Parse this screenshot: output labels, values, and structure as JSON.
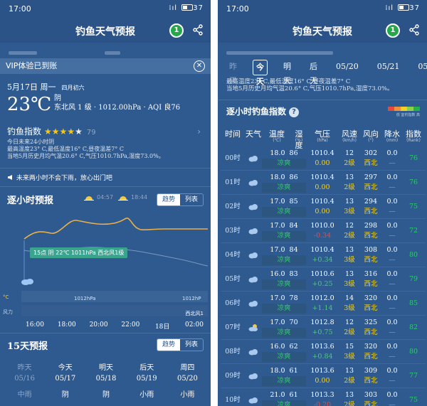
{
  "status": {
    "time": "17:00",
    "signal": "⁞ıl",
    "battery": "37"
  },
  "app_title": "钓鱼天气预报",
  "badge_number": "1",
  "left": {
    "vip_banner": "VIP体验已到账",
    "date": "5月17日 周一",
    "lunar": "四月初六",
    "temperature": "23℃",
    "weather": "阴",
    "wind_pressure_aqi": "东北风 1 级 · 1012.00hPa · AQI 良76",
    "fishing_index_label": "钓鱼指数",
    "fishing_index_score": "79",
    "fishing_stars": 4,
    "summary_lines": [
      "今日未来24小时阴",
      "最高温度23° C,最低温度16° C,昼夜温差7° C",
      "当地5月历史月均气温20.6° C,气压1010.7hPa,湿度73.0%。"
    ],
    "alert": "未来两小时不会下雨，放心出门吧",
    "hourly_title": "逐小时预报",
    "sunrise_time": "04:57",
    "sunset_time": "18:44",
    "toggle_trend": "趋势",
    "toggle_list": "列表",
    "tooltip": "15点 阴 22℃ 1011hPa 西北风1级",
    "temp_axis_label": "°C",
    "pressure_labels": [
      "1012hPa",
      "1012hP"
    ],
    "wind_label": "风力",
    "wind_dir_label": "西北风1",
    "hour_axis": [
      "16:00",
      "18:00",
      "20:00",
      "22:00",
      "18日",
      "02:00"
    ],
    "daily_title": "15天预报",
    "daily_names": [
      "昨天",
      "今天",
      "明天",
      "后天",
      "周四"
    ],
    "daily_dates": [
      "05/16",
      "05/17",
      "05/18",
      "05/19",
      "05/20"
    ],
    "daily_weather": [
      "中雨",
      "阴",
      "阴",
      "小雨",
      "小雨"
    ],
    "colors": {
      "accent_green": "#3aa48f",
      "star": "#f6c620",
      "temp_line": "#e8b04a"
    }
  },
  "right": {
    "tabs": [
      "昨天",
      "今天",
      "明天",
      "后天",
      "05/20",
      "05/21",
      "05/"
    ],
    "forecast_lines": [
      "最高温度23° C,最低温度16° C,昼夜温差7° C",
      "当地5月历史月均气温20.6° C,气压1010.7hPa,湿度73.0%。"
    ],
    "fishing_title": "逐小时钓鱼指数",
    "help": "?",
    "legend_label": "低 宜钓指数 高",
    "headers": [
      "时间",
      "天气",
      "温度",
      "湿度",
      "气压",
      "风速",
      "风向",
      "降水",
      "指数"
    ],
    "units": [
      "",
      "",
      "(℃)",
      "(%)",
      "(hPa)",
      "(km/h)",
      "(°)",
      "(mm)",
      "(Rank)"
    ],
    "rows": [
      {
        "hour": "00时",
        "temp": "18.0",
        "hum": "86",
        "comfort": "凉爽",
        "press": "1010.4",
        "dp": "0.00",
        "dpc": "dp",
        "speed": "12",
        "level": "2级",
        "dir_deg": "302",
        "dir": "西北",
        "rain": "0.0",
        "rain2": "—",
        "idx": "76",
        "icon": "cloud"
      },
      {
        "hour": "01时",
        "temp": "18.0",
        "hum": "86",
        "comfort": "凉爽",
        "press": "1010.4",
        "dp": "0.00",
        "dpc": "dp",
        "speed": "13",
        "level": "2级",
        "dir_deg": "297",
        "dir": "西北",
        "rain": "0.0",
        "rain2": "—",
        "idx": "76",
        "icon": "cloud"
      },
      {
        "hour": "02时",
        "temp": "17.0",
        "hum": "85",
        "comfort": "凉爽",
        "press": "1010.4",
        "dp": "0.00",
        "dpc": "dp",
        "speed": "13",
        "level": "3级",
        "dir_deg": "294",
        "dir": "西北",
        "rain": "0.0",
        "rain2": "—",
        "idx": "75",
        "icon": "cloud"
      },
      {
        "hour": "03时",
        "temp": "17.0",
        "hum": "84",
        "comfort": "凉爽",
        "press": "1010.0",
        "dp": "-0.34",
        "dpc": "dn",
        "speed": "12",
        "level": "2级",
        "dir_deg": "298",
        "dir": "西北",
        "rain": "0.0",
        "rain2": "—",
        "idx": "72",
        "icon": "cloud"
      },
      {
        "hour": "04时",
        "temp": "17.0",
        "hum": "84",
        "comfort": "凉爽",
        "press": "1010.4",
        "dp": "+0.34",
        "dpc": "dg",
        "speed": "13",
        "level": "3级",
        "dir_deg": "308",
        "dir": "西北",
        "rain": "0.0",
        "rain2": "—",
        "idx": "80",
        "icon": "cloud"
      },
      {
        "hour": "05时",
        "temp": "16.0",
        "hum": "83",
        "comfort": "凉爽",
        "press": "1010.6",
        "dp": "+0.25",
        "dpc": "dg",
        "speed": "13",
        "level": "3级",
        "dir_deg": "316",
        "dir": "西北",
        "rain": "0.0",
        "rain2": "—",
        "idx": "79",
        "icon": "cloud"
      },
      {
        "hour": "06时",
        "temp": "17.0",
        "hum": "78",
        "comfort": "凉爽",
        "press": "1012.0",
        "dp": "+1.14",
        "dpc": "dg",
        "speed": "14",
        "level": "3级",
        "dir_deg": "320",
        "dir": "西北",
        "rain": "0.0",
        "rain2": "—",
        "idx": "85",
        "icon": "cloud"
      },
      {
        "hour": "07时",
        "temp": "17.0",
        "hum": "70",
        "comfort": "凉爽",
        "press": "1012.8",
        "dp": "+0.75",
        "dpc": "dg",
        "speed": "12",
        "level": "2级",
        "dir_deg": "325",
        "dir": "西北",
        "rain": "0.0",
        "rain2": "—",
        "idx": "82",
        "icon": "suncloud"
      },
      {
        "hour": "08时",
        "temp": "16.0",
        "hum": "62",
        "comfort": "凉爽",
        "press": "1013.6",
        "dp": "+0.84",
        "dpc": "dg",
        "speed": "15",
        "level": "3级",
        "dir_deg": "320",
        "dir": "西北",
        "rain": "0.0",
        "rain2": "—",
        "idx": "80",
        "icon": "cloud"
      },
      {
        "hour": "09时",
        "temp": "18.0",
        "hum": "61",
        "comfort": "凉爽",
        "press": "1013.6",
        "dp": "0.00",
        "dpc": "dp",
        "speed": "13",
        "level": "2级",
        "dir_deg": "309",
        "dir": "西北",
        "rain": "0.0",
        "rain2": "—",
        "idx": "77",
        "icon": "cloud"
      },
      {
        "hour": "10时",
        "temp": "21.0",
        "hum": "61",
        "comfort": "凉爽",
        "press": "1013.3",
        "dp": "-0.20",
        "dpc": "dn",
        "speed": "13",
        "level": "2级",
        "dir_deg": "303",
        "dir": "西北",
        "rain": "0.0",
        "rain2": "—",
        "idx": "75",
        "icon": "cloud"
      }
    ]
  }
}
